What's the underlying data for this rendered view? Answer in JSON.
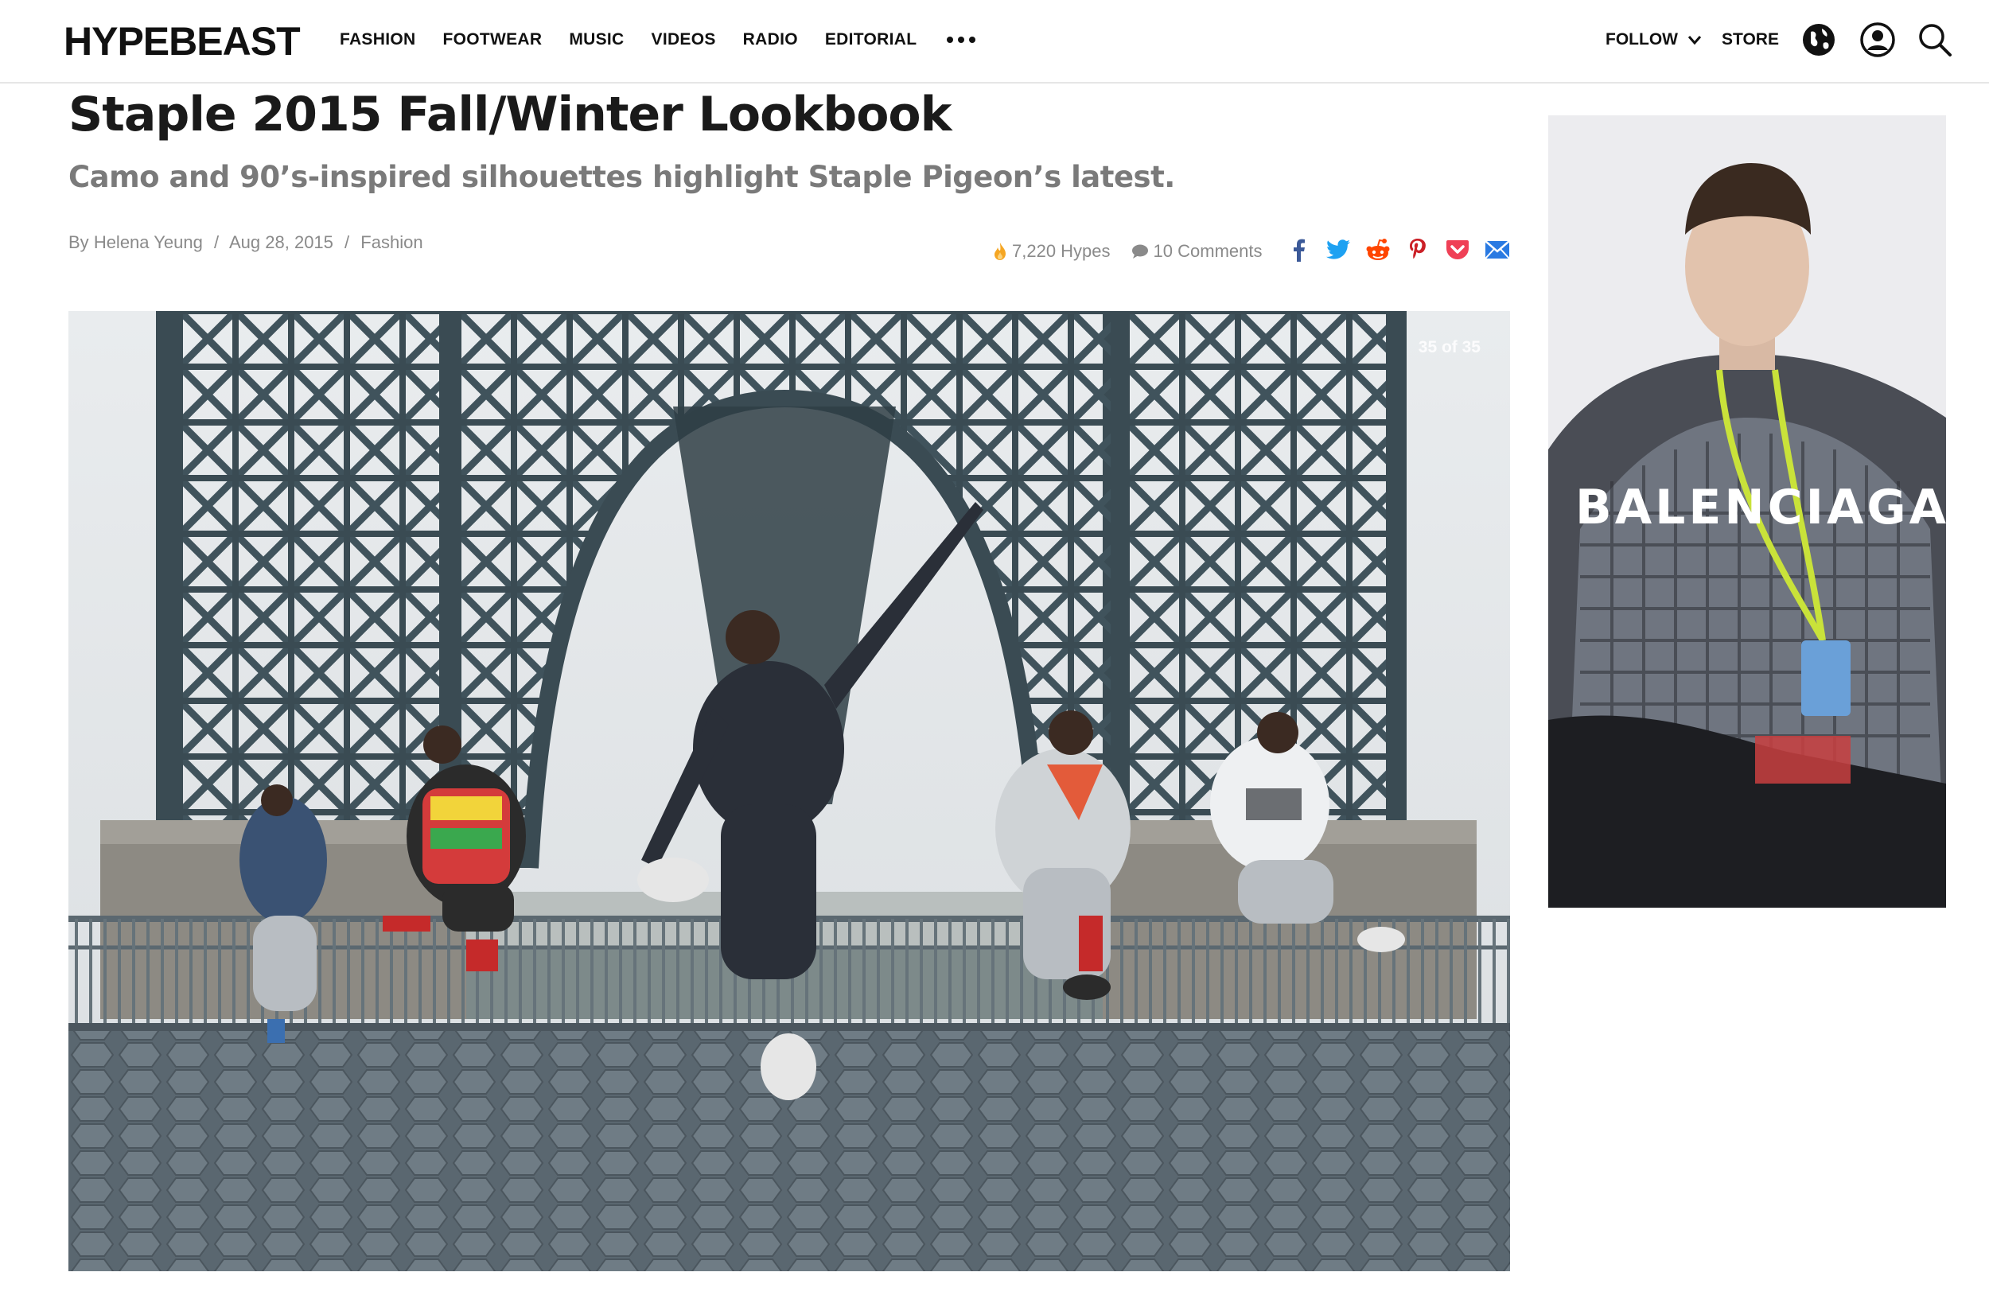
{
  "header": {
    "logo": "HYPEBEAST",
    "nav": [
      {
        "label": "FASHION"
      },
      {
        "label": "FOOTWEAR"
      },
      {
        "label": "MUSIC"
      },
      {
        "label": "VIDEOS"
      },
      {
        "label": "RADIO"
      },
      {
        "label": "EDITORIAL"
      }
    ],
    "more_icon": "ellipsis-icon",
    "follow_label": "FOLLOW",
    "store_label": "STORE",
    "icons": [
      "globe-icon",
      "user-icon",
      "search-icon"
    ]
  },
  "article": {
    "title": "Staple 2015 Fall/Winter Lookbook",
    "subtitle": "Camo and 90’s-inspired silhouettes highlight Staple Pigeon’s latest.",
    "byline": {
      "prefix": "By",
      "author": "Helena Yeung",
      "separator": "/",
      "date": "Aug 28, 2015",
      "category": "Fashion"
    },
    "stats": {
      "hypes": "7,220 Hypes",
      "comments": "10 Comments"
    },
    "share_icons": [
      "facebook-icon",
      "twitter-icon",
      "reddit-icon",
      "pinterest-icon",
      "pocket-icon",
      "email-icon"
    ],
    "gallery": {
      "counter": "35 of 35"
    }
  },
  "ad": {
    "brand": "BALENCIAGA"
  },
  "colors": {
    "text": "#111111",
    "muted": "#8a8a8a",
    "facebook": "#3b5998",
    "twitter": "#1da1f2",
    "reddit": "#ff4500",
    "pinterest": "#cb2027",
    "pocket": "#ef4056",
    "email": "#2a7ae2",
    "hype_flame": "#f5a623"
  }
}
